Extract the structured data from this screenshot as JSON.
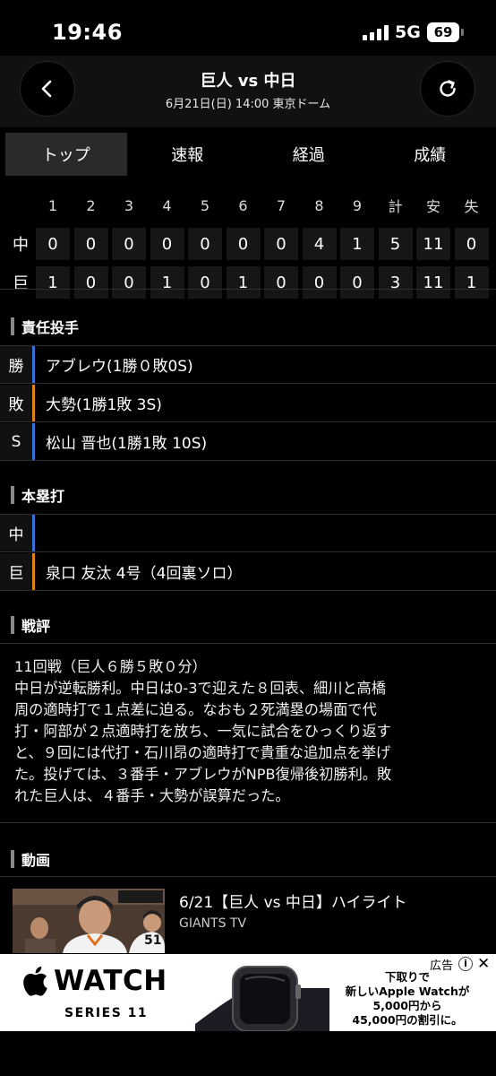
{
  "status_bar": {
    "time": "19:46",
    "network": "5G",
    "battery": "69"
  },
  "header": {
    "title": "巨人 vs 中日",
    "subtitle": "6月21日(日) 14:00 東京ドーム"
  },
  "tabs": [
    {
      "label": "トップ",
      "active": true
    },
    {
      "label": "速報",
      "active": false
    },
    {
      "label": "経過",
      "active": false
    },
    {
      "label": "成績",
      "active": false
    }
  ],
  "scoreboard": {
    "columns": [
      "1",
      "2",
      "3",
      "4",
      "5",
      "6",
      "7",
      "8",
      "9",
      "計",
      "安",
      "失"
    ],
    "rows": [
      {
        "team": "中",
        "values": [
          "0",
          "0",
          "0",
          "0",
          "0",
          "0",
          "0",
          "4",
          "1",
          "5",
          "11",
          "0"
        ]
      },
      {
        "team": "巨",
        "values": [
          "1",
          "0",
          "0",
          "1",
          "0",
          "1",
          "0",
          "0",
          "0",
          "3",
          "11",
          "1"
        ]
      }
    ]
  },
  "pitchers": {
    "heading": "責任投手",
    "rows": [
      {
        "label": "勝",
        "text": "アブレウ(1勝０敗0S)",
        "accent": "#3b6fd4"
      },
      {
        "label": "敗",
        "text": "大勢(1勝1敗 3S)",
        "accent": "#e0801d"
      },
      {
        "label": "S",
        "text": "松山 晋也(1勝1敗 10S)",
        "accent": "#3b6fd4"
      }
    ]
  },
  "homeruns": {
    "heading": "本塁打",
    "rows": [
      {
        "label": "中",
        "text": "",
        "accent": "#3b6fd4"
      },
      {
        "label": "巨",
        "text": "泉口 友汰 4号（4回裏ソロ）",
        "accent": "#e0801d"
      }
    ]
  },
  "review": {
    "heading": "戦評",
    "lines": [
      "11回戦（巨人６勝５敗０分）",
      "中日が逆転勝利。中日は0-3で迎えた８回表、細川と高橋",
      "周の適時打で１点差に迫る。なおも２死満塁の場面で代",
      "打・阿部が２点適時打を放ち、一気に試合をひっくり返す",
      "と、９回には代打・石川昂の適時打で貴重な追加点を挙げ",
      "た。投げては、３番手・アブレウがNPB復帰後初勝利。敗",
      "れた巨人は、４番手・大勢が誤算だった。"
    ]
  },
  "video": {
    "heading": "動画",
    "title": "6/21【巨人 vs 中日】ハイライト",
    "source": "GIANTS TV",
    "thumb_badge": "51"
  },
  "ad": {
    "label": "広告",
    "brand": "WATCH",
    "series": "SERIES 11",
    "promo_lines": [
      "下取りで",
      "新しいApple Watchが",
      "5,000円から",
      "45,000円の割引に。"
    ]
  },
  "icons": {
    "back": "chevron-left-icon",
    "reload": "reload-icon",
    "ad_info": "info-icon",
    "ad_close": "close-icon",
    "brand": "apple-logo-icon"
  },
  "colors": {
    "accent_blue": "#3b6fd4",
    "accent_orange": "#e0801d",
    "background": "#000000"
  }
}
